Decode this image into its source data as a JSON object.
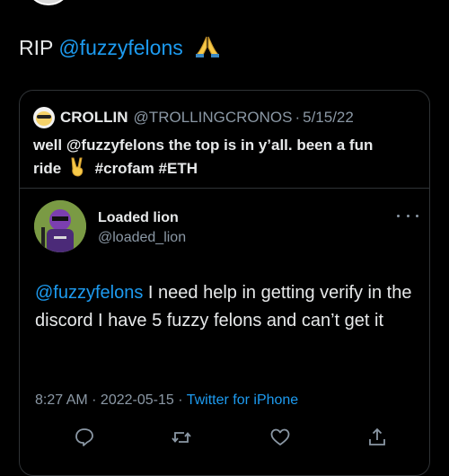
{
  "main_tweet": {
    "text_prefix": "RIP",
    "mention": "@fuzzyfelons"
  },
  "quoted_tweet": {
    "name": "CROLLIN",
    "handle": "@TROLLINGCRONOS",
    "separator": "·",
    "date": "5/15/22",
    "text_line1": "well @fuzzyfelons the top is in y’all. been a fun",
    "text_word": "ride",
    "hashtags": "#crofam #ETH"
  },
  "reply": {
    "name": "Loaded lion",
    "handle": "@loaded_lion",
    "mention": "@fuzzyfelons",
    "text": " I need help in getting verify in the discord I have 5 fuzzy felons and can’t get it",
    "time": "8:27 AM",
    "date": "2022-05-15",
    "separator": " · ",
    "source": "Twitter for iPhone"
  },
  "colors": {
    "background": "#000000",
    "text": "#e7e9ea",
    "secondary": "#8b98a5",
    "link": "#1d9bf0",
    "border": "#2f3336"
  },
  "icons": [
    "pray-emoji",
    "victory-hand-emoji",
    "more-icon",
    "reply-icon",
    "retweet-icon",
    "like-icon",
    "share-icon"
  ]
}
